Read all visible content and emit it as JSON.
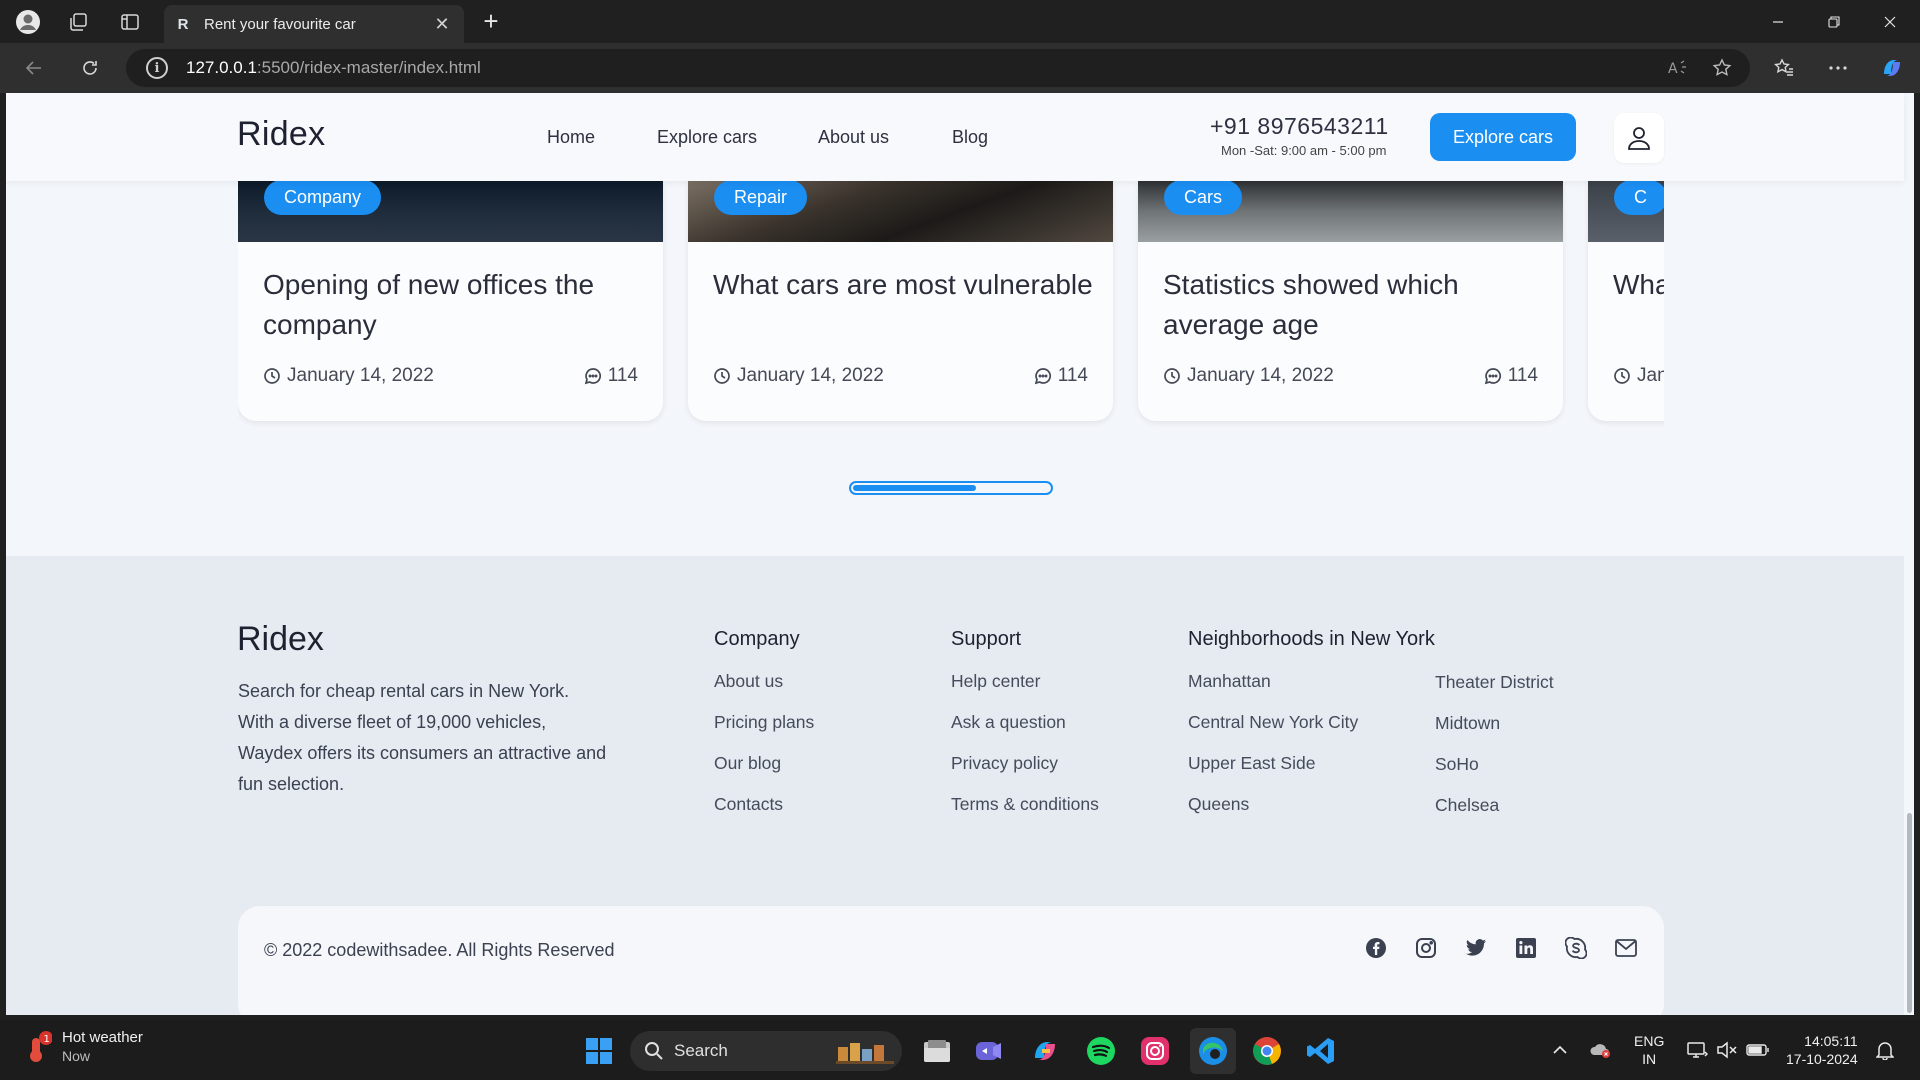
{
  "browser": {
    "tab_title": "Rent your favourite car",
    "tab_favicon_letter": "R",
    "url_host": "127.0.0.1",
    "url_rest": ":5500/ridex-master/index.html"
  },
  "site": {
    "logo": "Ridex",
    "nav": [
      "Home",
      "Explore cars",
      "About us",
      "Blog"
    ],
    "phone": "+91 8976543211",
    "hours": "Mon -Sat: 9:00 am - 5:00 pm",
    "cta": "Explore cars"
  },
  "blog_cards": [
    {
      "badge": "Company",
      "title": "Opening of new offices the company",
      "date": "January 14, 2022",
      "comments": "114"
    },
    {
      "badge": "Repair",
      "title": "What cars are most vulnerable",
      "date": "January 14, 2022",
      "comments": "114"
    },
    {
      "badge": "Cars",
      "title": "Statistics showed which average age",
      "date": "January 14, 2022",
      "comments": "114"
    },
    {
      "badge": "C",
      "title": "Wha rent",
      "date": "Jan",
      "comments": ""
    }
  ],
  "slider": {
    "progress": 0.63
  },
  "footer": {
    "logo": "Ridex",
    "description": "Search for cheap rental cars in New York. With a diverse fleet of 19,000 vehicles, Waydex offers its consumers an attractive and fun selection.",
    "company": {
      "title": "Company",
      "links": [
        "About us",
        "Pricing plans",
        "Our blog",
        "Contacts"
      ]
    },
    "support": {
      "title": "Support",
      "links": [
        "Help center",
        "Ask a question",
        "Privacy policy",
        "Terms & conditions"
      ]
    },
    "neighborhoods": {
      "title": "Neighborhoods in New York",
      "col1": [
        "Manhattan",
        "Central New York City",
        "Upper East Side",
        "Queens"
      ],
      "col2": [
        "Theater District",
        "Midtown",
        "SoHo",
        "Chelsea"
      ]
    },
    "copyright": "© 2022 codewithsadee. All Rights Reserved",
    "socials": [
      "facebook-icon",
      "instagram-icon",
      "twitter-icon",
      "linkedin-icon",
      "skype-icon",
      "mail-icon"
    ]
  },
  "taskbar": {
    "weather_title": "Hot weather",
    "weather_sub": "Now",
    "weather_badge": "1",
    "search": "Search",
    "lang1": "ENG",
    "lang2": "IN",
    "time": "14:05:11",
    "date": "17-10-2024"
  },
  "colors": {
    "accent": "#1b8ef2",
    "page_bg": "#f3f6fb",
    "footer_bg": "#e6ebf2"
  }
}
